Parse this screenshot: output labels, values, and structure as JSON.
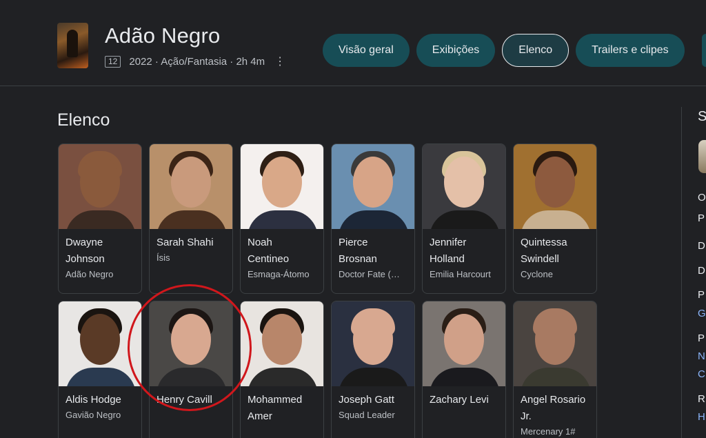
{
  "movie": {
    "title": "Adão Negro",
    "rating": "12",
    "meta": "2022 · Ação/Fantasia · 2h 4m"
  },
  "tabs": [
    {
      "label": "Visão geral",
      "active": false
    },
    {
      "label": "Exibições",
      "active": false
    },
    {
      "label": "Elenco",
      "active": true
    },
    {
      "label": "Trailers e clipes",
      "active": false
    }
  ],
  "section": {
    "title": "Elenco"
  },
  "cast": [
    {
      "name": "Dwayne Johnson",
      "role": "Adão Negro",
      "skin": "#8a5a3c",
      "hair": "#8a5a3c",
      "bg": "#7a5040",
      "shirt": "#3a2a22"
    },
    {
      "name": "Sarah Shahi",
      "role": "Ísis",
      "skin": "#c99a7c",
      "hair": "#3b2416",
      "bg": "#b8906a",
      "shirt": "#4a3020"
    },
    {
      "name": "Noah Centineo",
      "role": "Esmaga-Átomo",
      "skin": "#d9a888",
      "hair": "#2e1f15",
      "bg": "#f4f0ee",
      "shirt": "#2c3040"
    },
    {
      "name": "Pierce Brosnan",
      "role": "Doctor Fate (…",
      "skin": "#d7a487",
      "hair": "#3a3a3a",
      "bg": "#6a8fb0",
      "shirt": "#1c2636"
    },
    {
      "name": "Jennifer Holland",
      "role": "Emilia Harcourt",
      "skin": "#e4c0a8",
      "hair": "#d8c49a",
      "bg": "#3a3a3e",
      "shirt": "#1a1a1a"
    },
    {
      "name": "Quintessa Swindell",
      "role": "Cyclone",
      "skin": "#8d5a3e",
      "hair": "#2a1a10",
      "bg": "#a07030",
      "shirt": "#c8b090"
    },
    {
      "name": "Aldis Hodge",
      "role": "Gavião Negro",
      "skin": "#5a3a26",
      "hair": "#1a1410",
      "bg": "#e8e6e4",
      "shirt": "#2a3a50"
    },
    {
      "name": "Henry Cavill",
      "role": "",
      "skin": "#d8a890",
      "hair": "#1c1614",
      "bg": "#4a4846",
      "shirt": "#2a2a2c"
    },
    {
      "name": "Mohammed Amer",
      "role": "",
      "skin": "#b8866a",
      "hair": "#1a1410",
      "bg": "#e8e4e0",
      "shirt": "#2a2a2a"
    },
    {
      "name": "Joseph Gatt",
      "role": "Squad Leader",
      "skin": "#d8a890",
      "hair": "#d8a890",
      "bg": "#2a3040",
      "shirt": "#1a1a1a"
    },
    {
      "name": "Zachary Levi",
      "role": "",
      "skin": "#d0a088",
      "hair": "#2a1e16",
      "bg": "#7a7470",
      "shirt": "#1a1a1e"
    },
    {
      "name": "Angel Rosario Jr.",
      "role": "Mercenary 1#",
      "skin": "#a87a62",
      "hair": "#a87a62",
      "bg": "#4a4440",
      "shirt": "#3a3a30"
    }
  ],
  "side": {
    "header": "S",
    "lines": [
      {
        "text": "O",
        "blue": false
      },
      {
        "text": "P",
        "blue": false
      },
      {
        "text": "D",
        "blue": false
      },
      {
        "text": "D",
        "blue": false
      },
      {
        "text": "P",
        "blue": false
      },
      {
        "text": "G",
        "blue": true
      },
      {
        "text": "P",
        "blue": false
      },
      {
        "text": "N",
        "blue": true
      },
      {
        "text": "C",
        "blue": true
      },
      {
        "text": "R",
        "blue": false
      },
      {
        "text": "H",
        "blue": true
      }
    ]
  },
  "colors": {
    "background": "#202124",
    "tab": "#174d56",
    "highlight": "#d0171c"
  }
}
